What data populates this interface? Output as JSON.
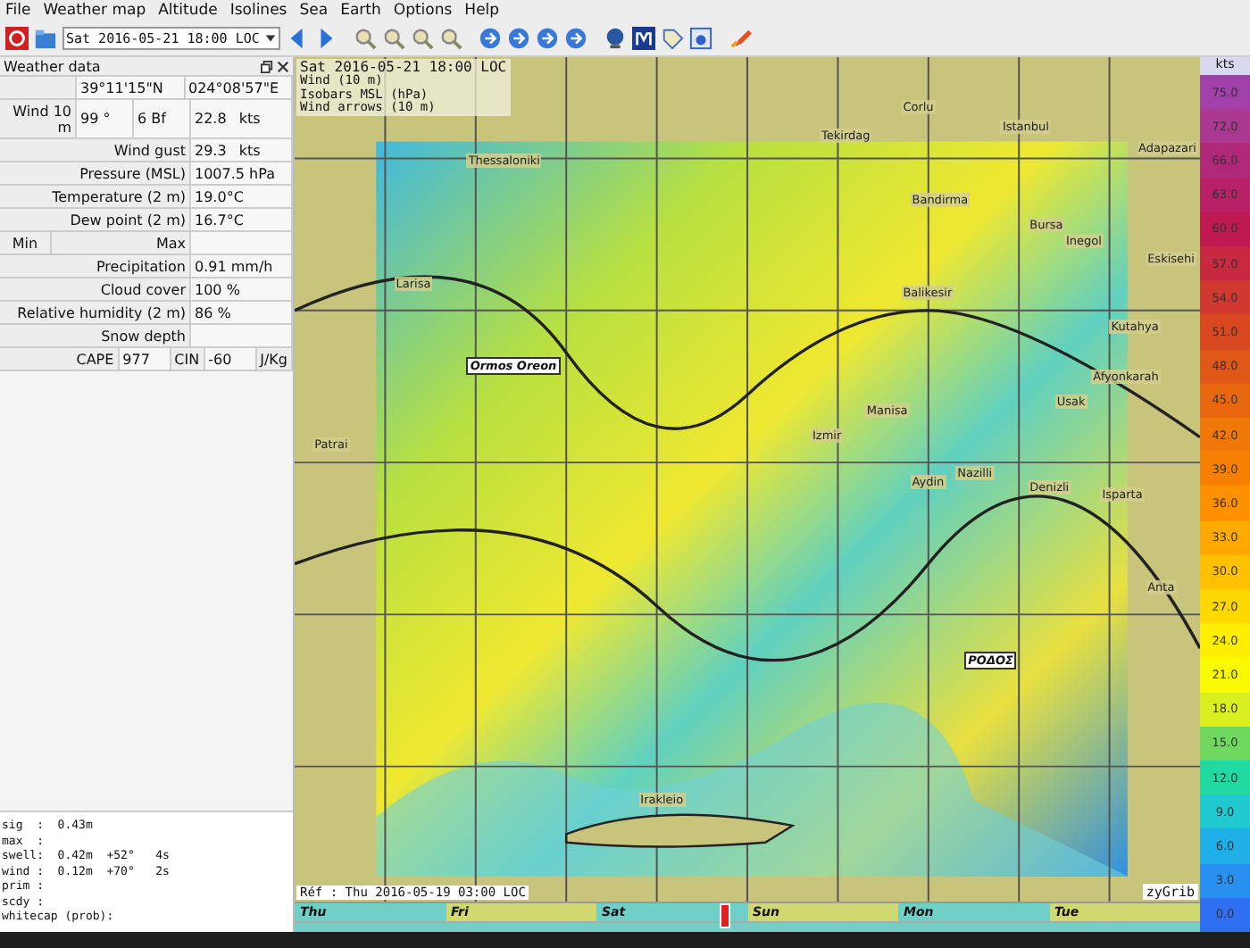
{
  "menu": [
    "File",
    "Weather map",
    "Altitude",
    "Isolines",
    "Sea",
    "Earth",
    "Options",
    "Help"
  ],
  "toolbar": {
    "date": "Sat 2016-05-21 18:00 LOC"
  },
  "panel": {
    "title": "Weather data",
    "lat": "39°11'15\"N",
    "lon": "024°08'57\"E",
    "wind": {
      "label": "Wind 10 m",
      "dir": "99 °",
      "bf": "6 Bf",
      "speed": "22.8",
      "unit": "kts"
    },
    "gust": {
      "label": "Wind gust",
      "value": "29.3",
      "unit": "kts"
    },
    "rows": [
      {
        "label": "Pressure (MSL)",
        "value": "1007.5 hPa"
      },
      {
        "label": "Temperature (2 m)",
        "value": "19.0°C"
      },
      {
        "label": "Dew point (2 m)",
        "value": "16.7°C"
      }
    ],
    "minmax": {
      "min": "Min",
      "max": "Max"
    },
    "rows2": [
      {
        "label": "Precipitation",
        "value": "0.91 mm/h"
      },
      {
        "label": "Cloud cover",
        "value": "100 %"
      },
      {
        "label": "Relative humidity (2 m)",
        "value": "86 %"
      },
      {
        "label": "Snow depth"
      }
    ],
    "cape": {
      "label": "CAPE",
      "value": "977",
      "cin_label": "CIN",
      "cin": "-60",
      "unit": "J/Kg"
    },
    "waves": [
      "sig  :  0.43m",
      "max  :",
      "swell:  0.42m  +52°   4s",
      "wind :  0.12m  +70°   2s",
      "prim :",
      "scdy :",
      "whitecap (prob):"
    ]
  },
  "map": {
    "legend": [
      "Sat 2016-05-21 18:00 LOC",
      "Wind (10 m)",
      "Isobars MSL (hPa)",
      "Wind arrows (10 m)"
    ],
    "places": [
      "Corlu",
      "Tekirdag",
      "Istanbul",
      "Adapazari",
      "Thessaloniki",
      "Bandirma",
      "Bursa",
      "Inegol",
      "Eskisehi",
      "Larisa",
      "Balikesir",
      "Kutahya",
      "Afyonkarah",
      "Usak",
      "Manisa",
      "Izmir",
      "Aydin",
      "Nazilli",
      "Denizli",
      "Isparta",
      "Patrai",
      "Anta",
      "Irakleio"
    ],
    "markers": [
      "Ormos Oreon",
      "ΡΟΔΟΣ"
    ],
    "ref": "Réf : Thu 2016-05-19 03:00 LOC",
    "brand": "zyGrib"
  },
  "scale": {
    "unit": "kts",
    "steps": [
      {
        "value": "75.0",
        "color": "#a040a8"
      },
      {
        "value": "72.0",
        "color": "#a83890"
      },
      {
        "value": "66.0",
        "color": "#b02878"
      },
      {
        "value": "63.0",
        "color": "#b82068"
      },
      {
        "value": "60.0",
        "color": "#c01850"
      },
      {
        "value": "57.0",
        "color": "#c82840"
      },
      {
        "value": "54.0",
        "color": "#d03830"
      },
      {
        "value": "51.0",
        "color": "#d84820"
      },
      {
        "value": "48.0",
        "color": "#e05818"
      },
      {
        "value": "45.0",
        "color": "#e86810"
      },
      {
        "value": "42.0",
        "color": "#f07808"
      },
      {
        "value": "39.0",
        "color": "#f88000"
      },
      {
        "value": "36.0",
        "color": "#ff9000"
      },
      {
        "value": "33.0",
        "color": "#ffa800"
      },
      {
        "value": "30.0",
        "color": "#ffc000"
      },
      {
        "value": "27.0",
        "color": "#ffd800"
      },
      {
        "value": "24.0",
        "color": "#ffee00"
      },
      {
        "value": "21.0",
        "color": "#f8f800"
      },
      {
        "value": "18.0",
        "color": "#d8f020"
      },
      {
        "value": "15.0",
        "color": "#70d860"
      },
      {
        "value": "12.0",
        "color": "#20d8a0"
      },
      {
        "value": "9.0",
        "color": "#20c8d0"
      },
      {
        "value": "6.0",
        "color": "#20b0e8"
      },
      {
        "value": "3.0",
        "color": "#2890f0"
      },
      {
        "value": "0.0",
        "color": "#3070f0"
      }
    ]
  },
  "timeline": {
    "level": 0.47,
    "days": [
      {
        "label": "Thu"
      },
      {
        "label": "Fri"
      },
      {
        "label": "Sat"
      },
      {
        "label": "Sun"
      },
      {
        "label": "Mon"
      },
      {
        "label": "Tue"
      }
    ]
  }
}
